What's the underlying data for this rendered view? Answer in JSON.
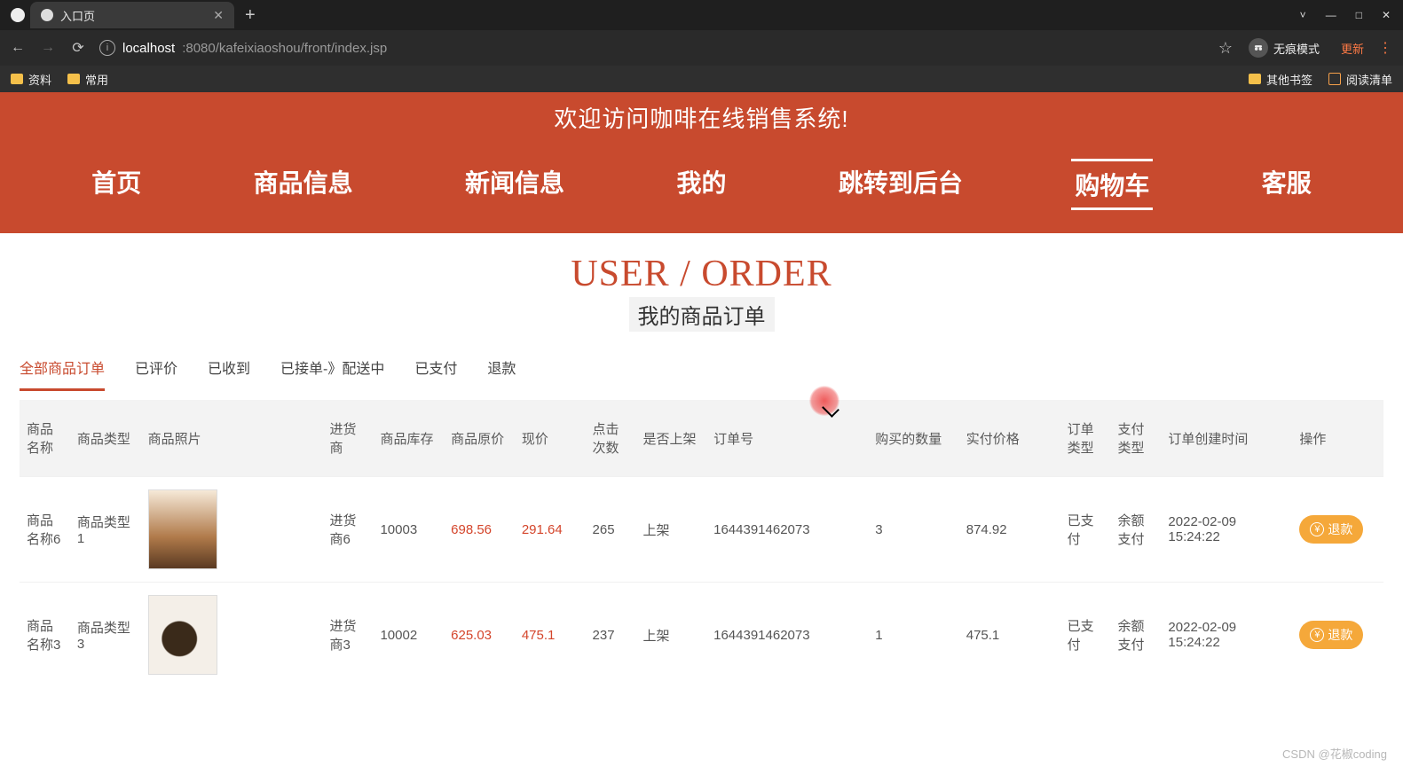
{
  "browser": {
    "tab_title": "入口页",
    "newtab_glyph": "+",
    "win": {
      "min": "—",
      "max": "□",
      "close": "✕",
      "chevron": "˅"
    },
    "nav": {
      "back": "←",
      "forward": "→",
      "reload": "⟳"
    },
    "info_glyph": "i",
    "url_host": "localhost",
    "url_path": ":8080/kafeixiaoshou/front/index.jsp",
    "star_glyph": "☆",
    "incognito_label": "无痕模式",
    "update_label": "更新",
    "menu_glyph": "⋮"
  },
  "bookmarks": {
    "items": [
      "资料",
      "常用"
    ],
    "other_label": "其他书签",
    "reading_label": "阅读清单"
  },
  "banner_text": "欢迎访问咖啡在线销售系统!",
  "nav_items": [
    "首页",
    "商品信息",
    "新闻信息",
    "我的",
    "跳转到后台",
    "购物车",
    "客服"
  ],
  "nav_active_index": 5,
  "page_title_en": "USER / ORDER",
  "page_title_cn": "我的商品订单",
  "order_tabs": [
    "全部商品订单",
    "已评价",
    "已收到",
    "已接单-》配送中",
    "已支付",
    "退款"
  ],
  "order_tabs_active_index": 0,
  "columns": [
    "商品名称",
    "商品类型",
    "商品照片",
    "进货商",
    "商品库存",
    "商品原价",
    "现价",
    "点击次数",
    "是否上架",
    "订单号",
    "购买的数量",
    "实付价格",
    "订单类型",
    "支付类型",
    "订单创建时间",
    "操作"
  ],
  "rows": [
    {
      "name": "商品名称6",
      "type": "商品类型1",
      "supplier": "进货商6",
      "stock": "10003",
      "orig": "698.56",
      "now": "291.64",
      "clicks": "265",
      "onshelf": "上架",
      "orderno": "1644391462073",
      "qty": "3",
      "paid": "874.92",
      "ordertype": "已支付",
      "paytype": "余额支付",
      "ctime": "2022-02-09 15:24:22",
      "op": "退款"
    },
    {
      "name": "商品名称3",
      "type": "商品类型3",
      "supplier": "进货商3",
      "stock": "10002",
      "orig": "625.03",
      "now": "475.1",
      "clicks": "237",
      "onshelf": "上架",
      "orderno": "1644391462073",
      "qty": "1",
      "paid": "475.1",
      "ordertype": "已支付",
      "paytype": "余额支付",
      "ctime": "2022-02-09 15:24:22",
      "op": "退款"
    }
  ],
  "watermark": "CSDN @花椒coding"
}
